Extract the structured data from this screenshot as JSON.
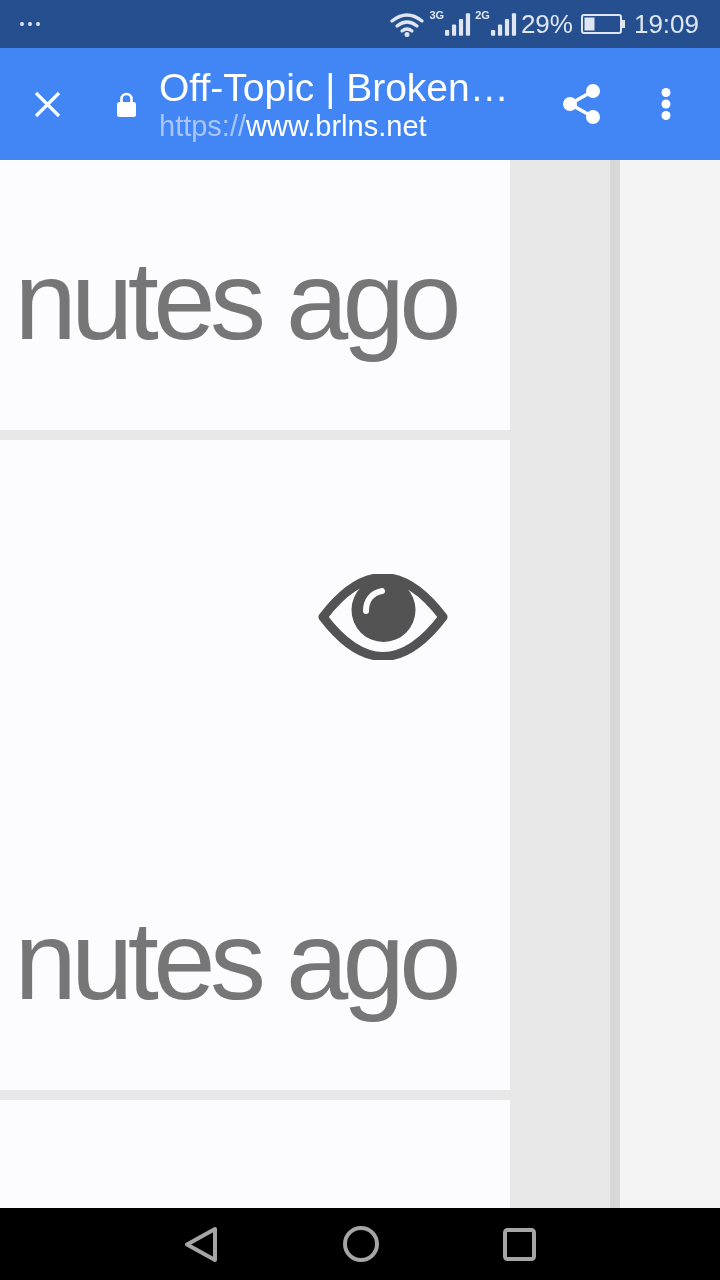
{
  "status_bar": {
    "signals": [
      {
        "label": "3G"
      },
      {
        "label": "2G"
      }
    ],
    "battery": "29%",
    "time": "19:09"
  },
  "toolbar": {
    "title": "Off-Topic | Broken…",
    "url_scheme": "https://",
    "url_host": "www.brlns.net"
  },
  "cards": [
    {
      "time": "nutes ago",
      "viewed": false
    },
    {
      "time": "nutes ago",
      "viewed": true
    }
  ]
}
